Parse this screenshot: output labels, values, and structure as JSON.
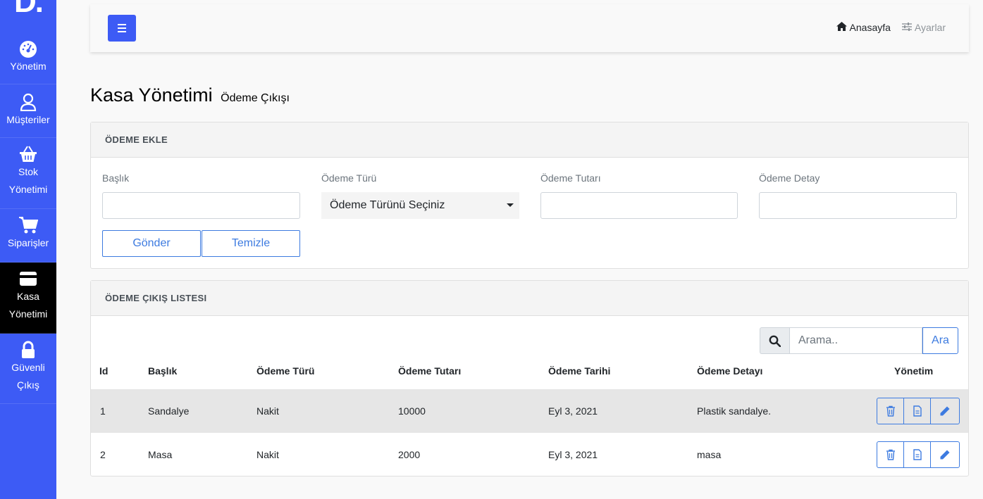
{
  "sidebar": {
    "brand": "D.",
    "items": [
      {
        "label": "Yönetim",
        "icon": "dashboard-icon"
      },
      {
        "label": "Müşteriler",
        "icon": "user-icon"
      },
      {
        "label_line1": "Stok",
        "label_line2": "Yönetimi",
        "icon": "basket-icon"
      },
      {
        "label": "Siparişler",
        "icon": "cart-icon"
      },
      {
        "label_line1": "Kasa",
        "label_line2": "Yönetimi",
        "icon": "card-icon",
        "active": true
      },
      {
        "label_line1": "Güvenli",
        "label_line2": "Çıkış",
        "icon": "lock-icon"
      }
    ]
  },
  "topbar": {
    "home_label": "Anasayfa",
    "settings_label": "Ayarlar"
  },
  "page": {
    "title": "Kasa Yönetimi",
    "subtitle": "Ödeme Çıkışı"
  },
  "form_card": {
    "header": "ÖDEME EKLE",
    "fields": {
      "title_label": "Başlık",
      "type_label": "Ödeme Türü",
      "type_value": "Ödeme Türünü Seçiniz",
      "amount_label": "Ödeme Tutarı",
      "detail_label": "Ödeme Detay"
    },
    "submit_label": "Gönder",
    "clear_label": "Temizle"
  },
  "list_card": {
    "header": "ÖDEME ÇIKIŞ LISTESI",
    "search_placeholder": "Arama..",
    "search_button": "Ara",
    "columns": [
      "Id",
      "Başlık",
      "Ödeme Türü",
      "Ödeme Tutarı",
      "Ödeme Tarihi",
      "Ödeme Detayı",
      "Yönetim"
    ],
    "rows": [
      {
        "id": "1",
        "title": "Sandalye",
        "type": "Nakit",
        "amount": "10000",
        "date": "Eyl 3, 2021",
        "detail": "Plastik sandalye."
      },
      {
        "id": "2",
        "title": "Masa",
        "type": "Nakit",
        "amount": "2000",
        "date": "Eyl 3, 2021",
        "detail": "masa"
      }
    ]
  },
  "colors": {
    "primary": "#3d5bf5",
    "outline": "#3d7be0",
    "active_nav": "#000000"
  }
}
